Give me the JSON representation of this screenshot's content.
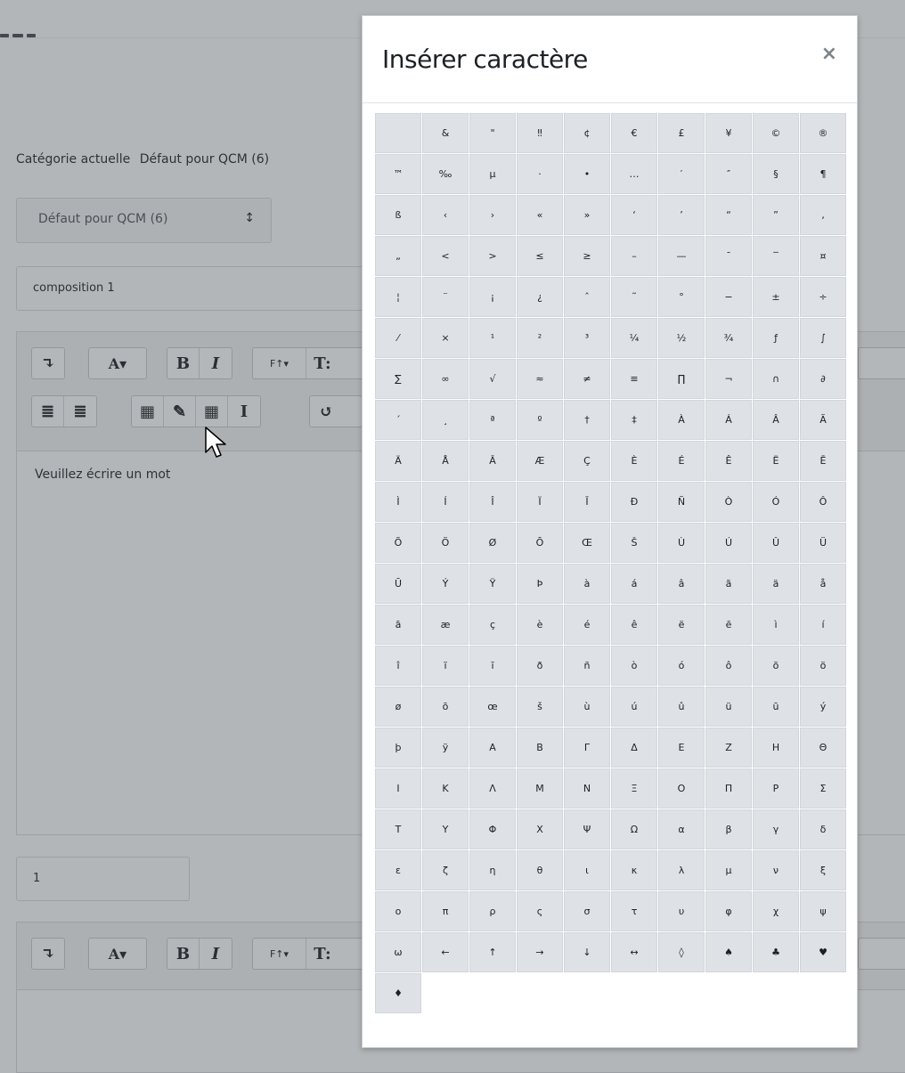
{
  "background": {
    "category_label": "Catégorie actuelle",
    "category_value": "Défaut pour QCM (6)",
    "category_select": "Défaut pour QCM (6)",
    "category_select_caret": "↕",
    "name_value": "composition 1",
    "editor_text": "Veuillez écrire un mot",
    "number_value": "1",
    "toolbar": {
      "para_icon": "↴",
      "font_color": "A▾",
      "bold": "B",
      "italic": "I",
      "font_family": "F↑▾",
      "font_size": "T:",
      "outdent_icon": "≣",
      "indent_icon": "≣",
      "calc_icon": "▦",
      "edit_icon": "✎",
      "table_icon": "▦",
      "cursor_icon": "I",
      "undo_icon": "↺"
    }
  },
  "modal": {
    "title": "Insérer caractère",
    "close": "×",
    "characters": [
      " ",
      "&",
      "\"",
      "‼",
      "¢",
      "€",
      "£",
      "¥",
      "©",
      "®",
      "™",
      "‰",
      "µ",
      "·",
      "•",
      "…",
      "′",
      "″",
      "§",
      "¶",
      "ß",
      "‹",
      "›",
      "«",
      "»",
      "‘",
      "’",
      "“",
      "”",
      "‚",
      "„",
      "<",
      ">",
      "≤",
      "≥",
      "–",
      "—",
      "¯",
      "‾",
      "¤",
      "¦",
      "¨",
      "¡",
      "¿",
      "ˆ",
      "˜",
      "°",
      "−",
      "±",
      "÷",
      "⁄",
      "×",
      "¹",
      "²",
      "³",
      "¼",
      "½",
      "¾",
      "ƒ",
      "∫",
      "∑",
      "∞",
      "√",
      "≈",
      "≠",
      "≡",
      "∏",
      "¬",
      "∩",
      "∂",
      "´",
      "¸",
      "ª",
      "º",
      "†",
      "‡",
      "À",
      "Á",
      "Â",
      "Ã",
      "Ä",
      "Å",
      "Ā",
      "Æ",
      "Ç",
      "È",
      "É",
      "Ê",
      "Ë",
      "Ē",
      "Ì",
      "Í",
      "Î",
      "Ï",
      "Ī",
      "Ð",
      "Ñ",
      "Ò",
      "Ó",
      "Ô",
      "Õ",
      "Ö",
      "Ø",
      "Ō",
      "Œ",
      "Š",
      "Ù",
      "Ú",
      "Û",
      "Ü",
      "Ū",
      "Ý",
      "Ÿ",
      "Þ",
      "à",
      "á",
      "â",
      "ã",
      "ä",
      "å",
      "ā",
      "æ",
      "ç",
      "è",
      "é",
      "ê",
      "ë",
      "ē",
      "ì",
      "í",
      "î",
      "ï",
      "ī",
      "ð",
      "ñ",
      "ò",
      "ó",
      "ô",
      "õ",
      "ö",
      "ø",
      "ō",
      "œ",
      "š",
      "ù",
      "ú",
      "û",
      "ü",
      "ū",
      "ý",
      "þ",
      "ÿ",
      "Α",
      "Β",
      "Γ",
      "Δ",
      "Ε",
      "Ζ",
      "Η",
      "Θ",
      "Ι",
      "Κ",
      "Λ",
      "Μ",
      "Ν",
      "Ξ",
      "Ο",
      "Π",
      "Ρ",
      "Σ",
      "Τ",
      "Υ",
      "Φ",
      "Χ",
      "Ψ",
      "Ω",
      "α",
      "β",
      "γ",
      "δ",
      "ε",
      "ζ",
      "η",
      "θ",
      "ι",
      "κ",
      "λ",
      "μ",
      "ν",
      "ξ",
      "ο",
      "π",
      "ρ",
      "ς",
      "σ",
      "τ",
      "υ",
      "φ",
      "χ",
      "ψ",
      "ω",
      "←",
      "↑",
      "→",
      "↓",
      "↔",
      "◊",
      "♠",
      "♣",
      "♥",
      "♦"
    ]
  }
}
